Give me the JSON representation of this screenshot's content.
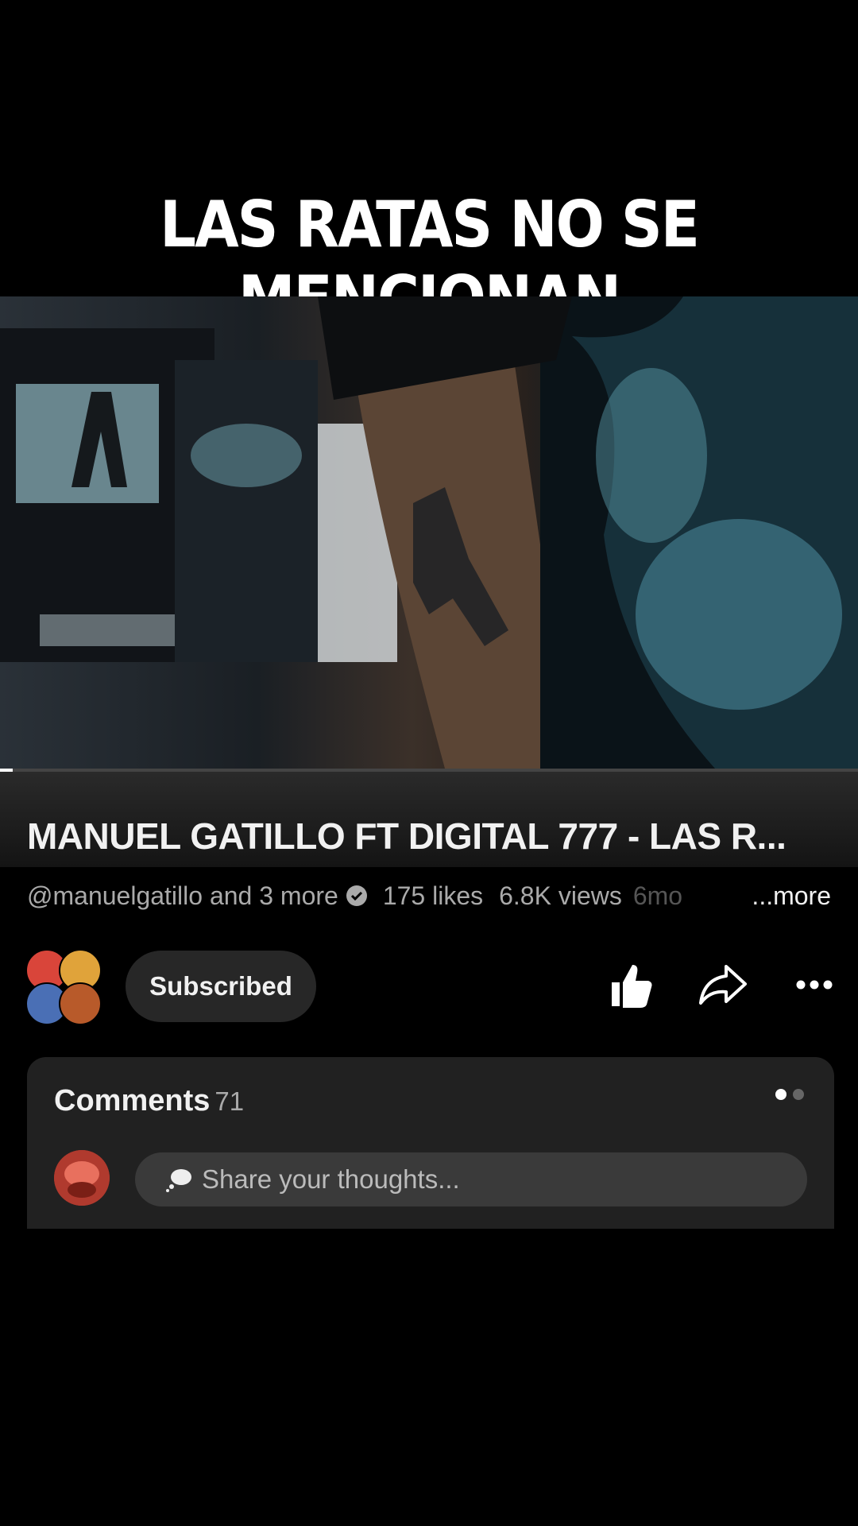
{
  "overlay": {
    "caption": "LAS RATAS NO SE MENCIONAN"
  },
  "video": {
    "title": "MANUEL GATILLO FT DIGITAL 777 - LAS R...",
    "progress": 0.015
  },
  "meta": {
    "authors": "@manuelgatillo and 3 more",
    "likes": "175 likes",
    "views": "6.8K views",
    "age_partial": "6mo",
    "more_label": "...more"
  },
  "channel": {
    "subscribe_label": "Subscribed"
  },
  "actions": {
    "like_icon": "thumbs-up-icon",
    "share_icon": "share-icon",
    "menu_icon": "more-horizontal-icon"
  },
  "comments": {
    "label": "Comments",
    "count": "71",
    "input_placeholder": "Share your thoughts..."
  },
  "colors": {
    "background": "#000000",
    "card": "#212121",
    "chip": "#272727",
    "accent_red": "#e53935"
  }
}
